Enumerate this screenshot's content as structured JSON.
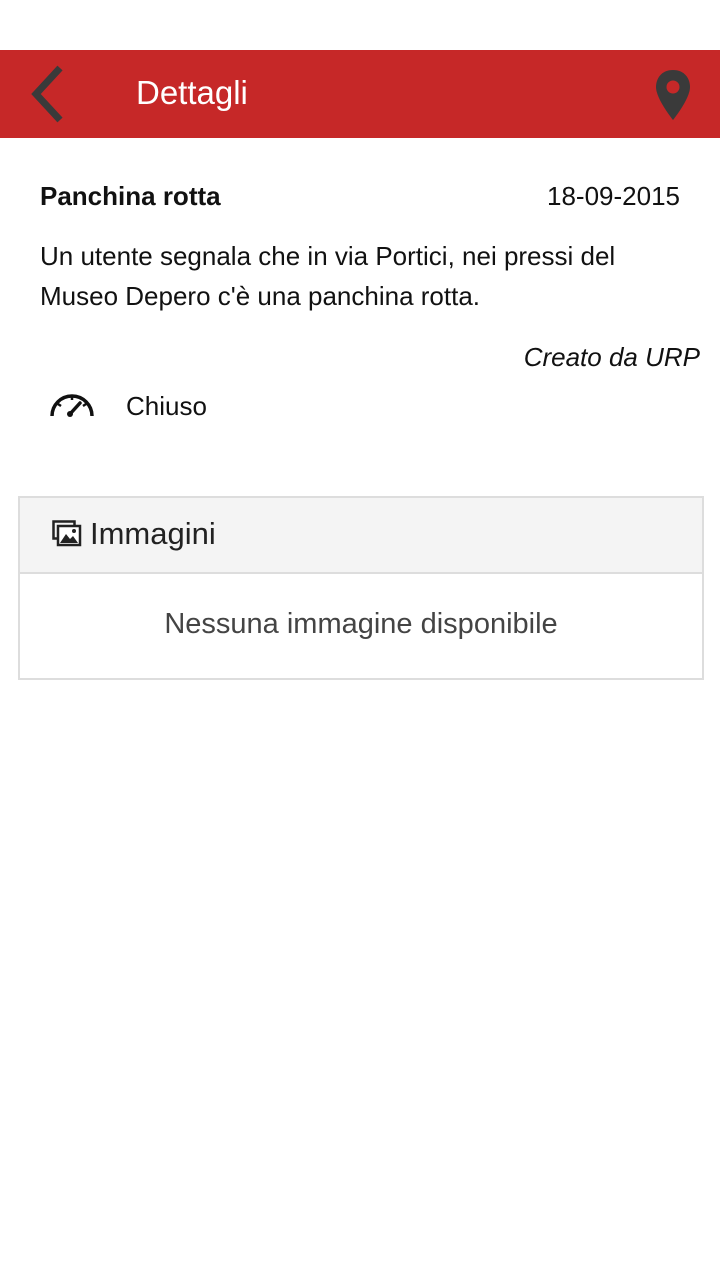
{
  "colors": {
    "app_bar": "#c62828",
    "back_icon": "#3a3a3a",
    "map_icon": "#3a3a3a",
    "panel_header_bg": "#f4f4f4",
    "panel_border": "#dddddd"
  },
  "app_bar": {
    "title": "Dettagli",
    "back_icon": "chevron-left-icon",
    "map_icon": "map-pin-icon"
  },
  "detail": {
    "title": "Panchina rotta",
    "date": "18-09-2015",
    "description": "Un utente segnala che in via Portici, nei pressi del Museo Depero c'è una panchina rotta.",
    "creator": "Creato da URP",
    "status_icon": "speedometer-icon",
    "status": "Chiuso"
  },
  "images": {
    "header_icon": "images-icon",
    "header": "Immagini",
    "empty_text": "Nessuna immagine disponibile"
  }
}
